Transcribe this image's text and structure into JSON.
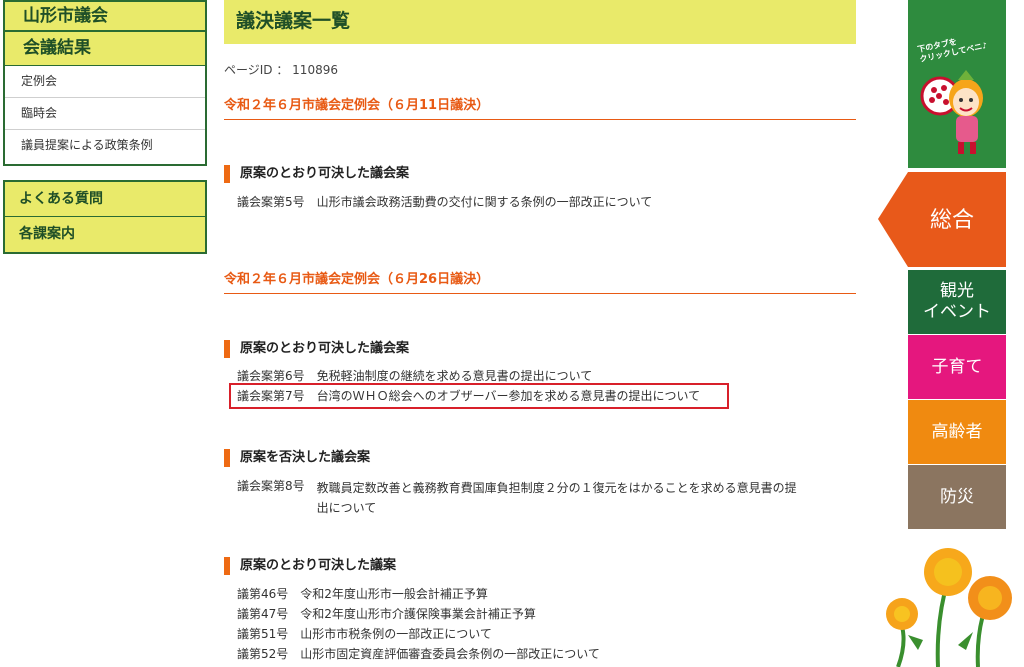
{
  "sidebar": {
    "title": "山形市議会",
    "section": "会議結果",
    "items": [
      "定例会",
      "臨時会",
      "議員提案による政策条例"
    ],
    "links": [
      "よくある質問",
      "各課案内"
    ]
  },
  "main": {
    "title": "議決議案一覧",
    "page_id": "ページID ： 110896",
    "sections": [
      {
        "title": "令和２年６月市議会定例会（６月11日議決）",
        "groups": [
          {
            "heading": "原案のとおり可決した議会案",
            "rows": [
              {
                "num": "議会案第5号",
                "text": "山形市議会政務活動費の交付に関する条例の一部改正について"
              }
            ]
          }
        ]
      },
      {
        "title": "令和２年６月市議会定例会（６月26日議決）",
        "groups": [
          {
            "heading": "原案のとおり可決した議会案",
            "rows": [
              {
                "num": "議会案第6号",
                "text": "免税軽油制度の継続を求める意見書の提出について"
              },
              {
                "num": "議会案第7号",
                "text": "台湾のＷＨＯ総会へのオブザーバー参加を求める意見書の提出について"
              }
            ]
          },
          {
            "heading": "原案を否決した議会案",
            "rows": [
              {
                "num": "議会案第8号",
                "text": "教職員定数改善と義務教育費国庫負担制度２分の１復元をはかることを求める意見書の提出について"
              }
            ]
          },
          {
            "heading": "原案のとおり可決した議案",
            "rows": [
              {
                "num": "議第46号",
                "text": "令和2年度山形市一般会計補正予算"
              },
              {
                "num": "議第47号",
                "text": "令和2年度山形市介護保険事業会計補正予算"
              },
              {
                "num": "議第51号",
                "text": "山形市市税条例の一部改正について"
              },
              {
                "num": "議第52号",
                "text": "山形市固定資産評価審査委員会条例の一部改正について"
              }
            ]
          }
        ]
      }
    ]
  },
  "right_tabs": {
    "mascot_note": "下のタブを\nクリックしてベニ♪",
    "active": "総合",
    "tabs": [
      {
        "label": "観光\nイベント",
        "color": "#1f6b3a"
      },
      {
        "label": "子育て",
        "color": "#e5177e"
      },
      {
        "label": "高齢者",
        "color": "#f08a10"
      },
      {
        "label": "防災",
        "color": "#8b7560"
      }
    ],
    "active_color": "#e8591a"
  }
}
